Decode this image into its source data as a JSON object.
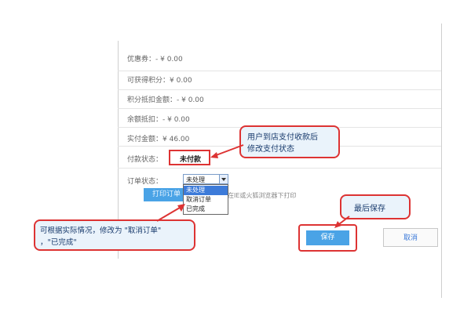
{
  "form": {
    "coupon": "优惠券：- ¥ 0.00",
    "points_earnable": "可获得积分：¥ 0.00",
    "points_deduct": "积分抵扣金额：- ¥ 0.00",
    "balance_deduct": "余额抵扣：- ¥ 0.00",
    "actual_amount": "实付金额：¥ 46.00",
    "payment_status_label": "付款状态：",
    "payment_status_value": "未付款",
    "order_status_label": "订单状态："
  },
  "order_status_select": {
    "selected": "未处理",
    "options": [
      "未处理",
      "取消订单",
      "已完成"
    ]
  },
  "print": {
    "button_label": "打印订单",
    "note": "在IE或火狐浏览器下打印"
  },
  "annotations": {
    "top_callout": "用户到店支付收款后\n修改支付状态",
    "left_callout": "可根据实际情况，修改为 \"取消订单\"\n，\"已完成\"",
    "save_callout": "最后保存"
  },
  "buttons": {
    "save": "保存",
    "cancel": "取消"
  },
  "colors": {
    "accent_blue": "#4aa3e6",
    "annotation_red": "#d33",
    "callout_fill": "#eaf3fb"
  }
}
